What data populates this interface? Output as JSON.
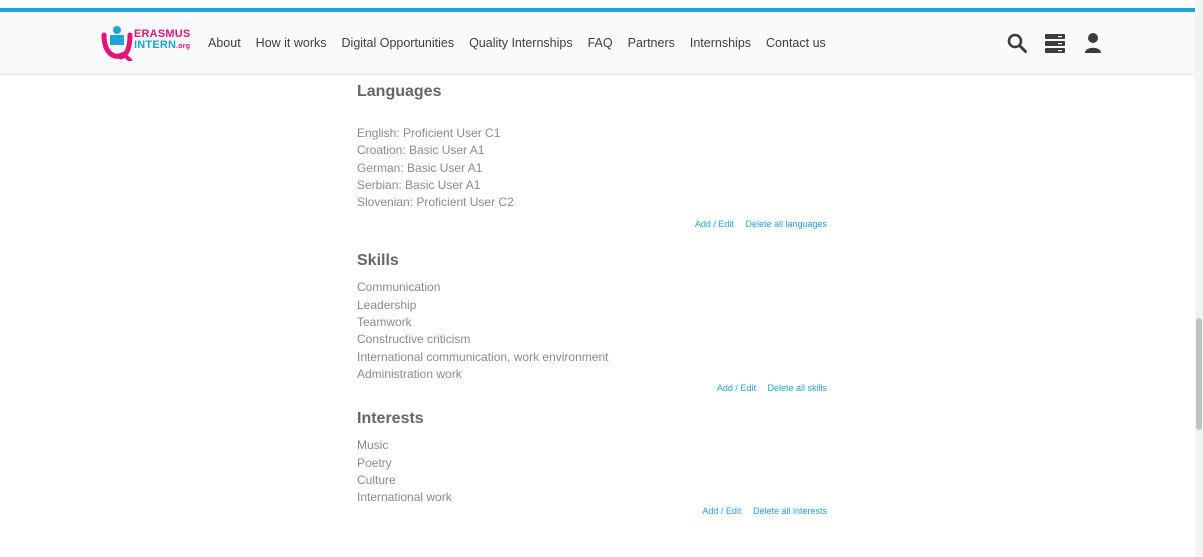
{
  "header": {
    "logo": {
      "line1": "ERASMUS",
      "line2": "INTERN",
      "suffix": ".org"
    },
    "nav": [
      "About",
      "How it works",
      "Digital Opportunities",
      "Quality Internships",
      "FAQ",
      "Partners",
      "Internships",
      "Contact us"
    ],
    "icons": [
      "search-icon",
      "server-menu-icon",
      "user-icon"
    ]
  },
  "colors": {
    "accent": "#1fa3dc",
    "brand_pink": "#e4147a",
    "heading": "#666666",
    "text": "#8a8a8a"
  },
  "languages": {
    "title": "Languages",
    "items": [
      "English: Proficient User C1",
      "Croation: Basic User A1",
      "German: Basic User A1",
      "Serbian: Basic User A1",
      "Slovenian: Proficient User C2"
    ],
    "edit_label": "Add / Edit",
    "delete_label": "Delete all languages"
  },
  "skills": {
    "title": "Skills",
    "items": [
      "Communication",
      "Leadership",
      "Teamwork",
      "Constructive criticism",
      "International communication, work environment",
      "Administration work"
    ],
    "edit_label": "Add / Edit",
    "delete_label": "Delete all skills"
  },
  "interests": {
    "title": "Interests",
    "items": [
      "Music",
      "Poetry",
      "Culture",
      "International work"
    ],
    "edit_label": "Add / Edit",
    "delete_label": "Delete all interests"
  }
}
